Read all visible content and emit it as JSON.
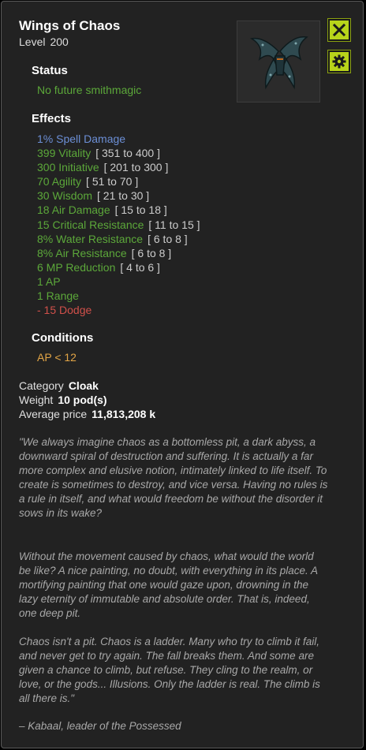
{
  "item": {
    "name": "Wings of Chaos",
    "level_label": "Level",
    "level": "200"
  },
  "buttons": {
    "close_icon": "close-x-icon",
    "settings_icon": "gear-icon"
  },
  "status": {
    "heading": "Status",
    "text": "No future smithmagic"
  },
  "effects": {
    "heading": "Effects",
    "items": [
      {
        "text": "1% Spell Damage",
        "range": ""
      },
      {
        "text": "399 Vitality",
        "range": "[ 351 to 400 ]"
      },
      {
        "text": "300 Initiative",
        "range": "[ 201 to 300 ]"
      },
      {
        "text": "70 Agility",
        "range": "[ 51 to 70 ]"
      },
      {
        "text": "30 Wisdom",
        "range": "[ 21 to 30 ]"
      },
      {
        "text": "18 Air Damage",
        "range": "[ 15 to 18 ]"
      },
      {
        "text": "15 Critical Resistance",
        "range": "[ 11 to 15 ]"
      },
      {
        "text": "8% Water Resistance",
        "range": "[ 6 to 8 ]"
      },
      {
        "text": "8% Air Resistance",
        "range": "[ 6 to 8 ]"
      },
      {
        "text": "6 MP Reduction",
        "range": "[ 4 to 6 ]"
      },
      {
        "text": "1 AP",
        "range": ""
      },
      {
        "text": "1 Range",
        "range": ""
      },
      {
        "text": "- 15 Dodge",
        "range": ""
      }
    ]
  },
  "conditions": {
    "heading": "Conditions",
    "text": "AP < 12"
  },
  "meta": {
    "category_label": "Category",
    "category_value": "Cloak",
    "weight_label": "Weight",
    "weight_value": "10 pod(s)",
    "price_label": "Average price",
    "price_value": "11,813,208 k"
  },
  "description": {
    "p1": "\"We always imagine chaos as a bottomless pit, a dark abyss, a downward spiral of destruction and suffering. It is actually a far more complex and elusive notion, intimately linked to life itself. To create is sometimes to destroy, and vice versa. Having no rules is a rule in itself, and what would freedom be without the disorder it sows in its wake?",
    "p2": "Without the movement caused by chaos, what would the world be like? A nice painting, no doubt, with everything in its place. A mortifying painting that one would gaze upon, drowning in the lazy eternity of immutable and absolute order. That is, indeed, one deep pit.",
    "p3": "Chaos isn't a pit. Chaos is a ladder. Many who try to climb it fail, and never get to try again. The fall breaks them. And some are given a chance to climb, but refuse. They cling to the realm, or love, or the gods... Illusions. Only the ladder is real. The climb is all there is.\"",
    "p4": "– Kabaal, leader of the Possessed"
  },
  "colors": {
    "panel_bg": "#222222",
    "accent_button": "#b8d41a",
    "effect_green": "#5ca83a",
    "effect_blue": "#6c8fd6",
    "effect_red": "#d0504a",
    "condition_orange": "#e2a546"
  }
}
